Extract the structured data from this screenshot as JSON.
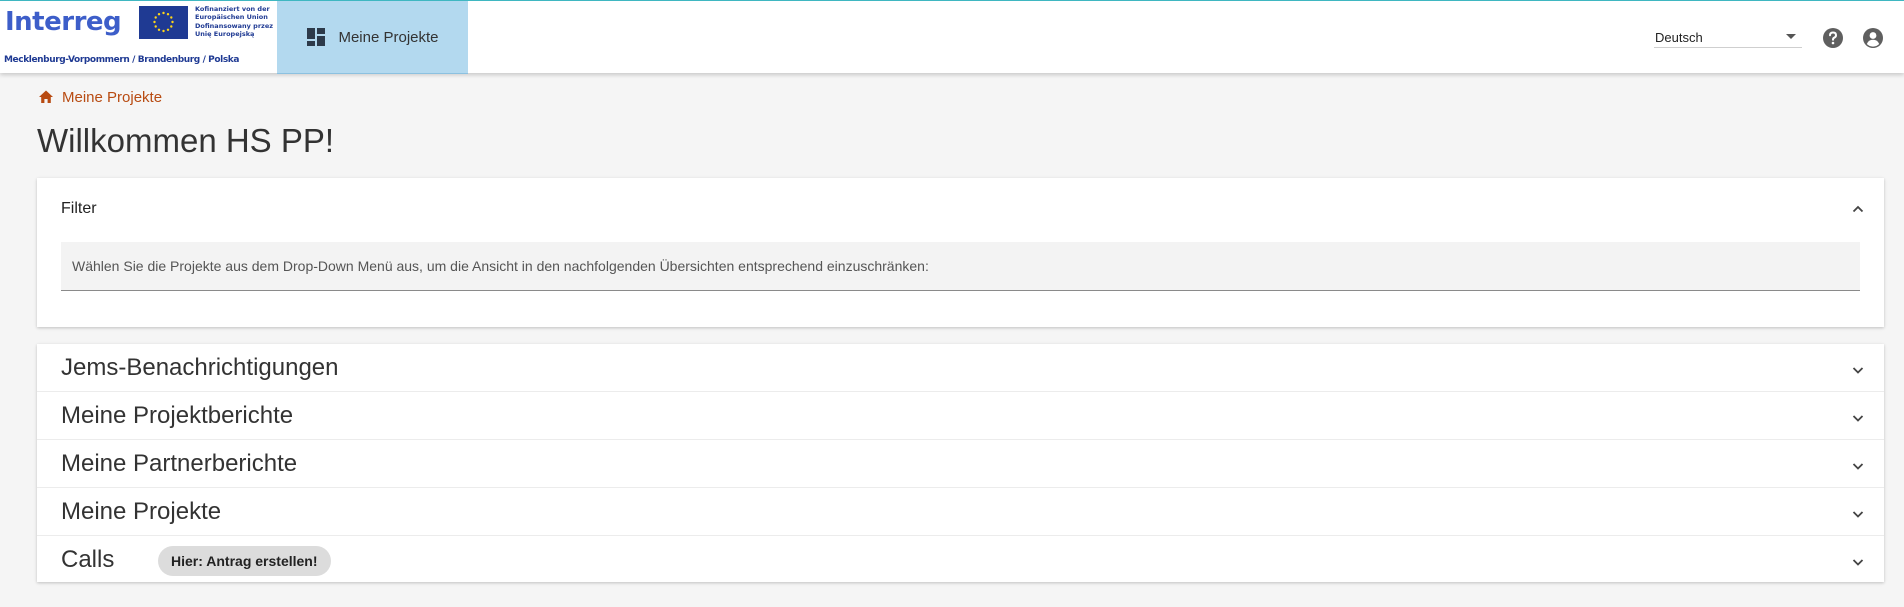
{
  "header": {
    "logo": {
      "wordmark": "Interreg",
      "eu_lines": [
        "Kofinanziert von der",
        "Europäischen Union"
      ],
      "pl_lines": [
        "Dofinansowany przez",
        "Unię Europejską"
      ],
      "region": "Mecklenburg-Vorpommern / Brandenburg / Polska"
    },
    "nav_tab": {
      "label": "Meine Projekte",
      "icon": "dashboard-icon"
    },
    "language": {
      "selected": "Deutsch"
    },
    "icons": [
      "help-icon",
      "account-icon"
    ],
    "colors": {
      "accent_tab": "#b3d9ef",
      "top_border": "#3fb7c1",
      "link": "#b84b12"
    }
  },
  "breadcrumb": {
    "icon": "home-icon",
    "label": "Meine Projekte"
  },
  "page_title": "Willkommen HS PP!",
  "filter": {
    "title": "Filter",
    "placeholder": "Wählen Sie die Projekte aus dem Drop-Down Menü aus, um die Ansicht in den nachfolgenden Übersichten entsprechend einzuschränken:"
  },
  "sections": [
    {
      "title": "Jems-Benachrichtigungen"
    },
    {
      "title": "Meine Projektberichte"
    },
    {
      "title": "Meine Partnerberichte"
    },
    {
      "title": "Meine Projekte"
    },
    {
      "title": "Calls",
      "chip": "Hier: Antrag erstellen!"
    }
  ]
}
